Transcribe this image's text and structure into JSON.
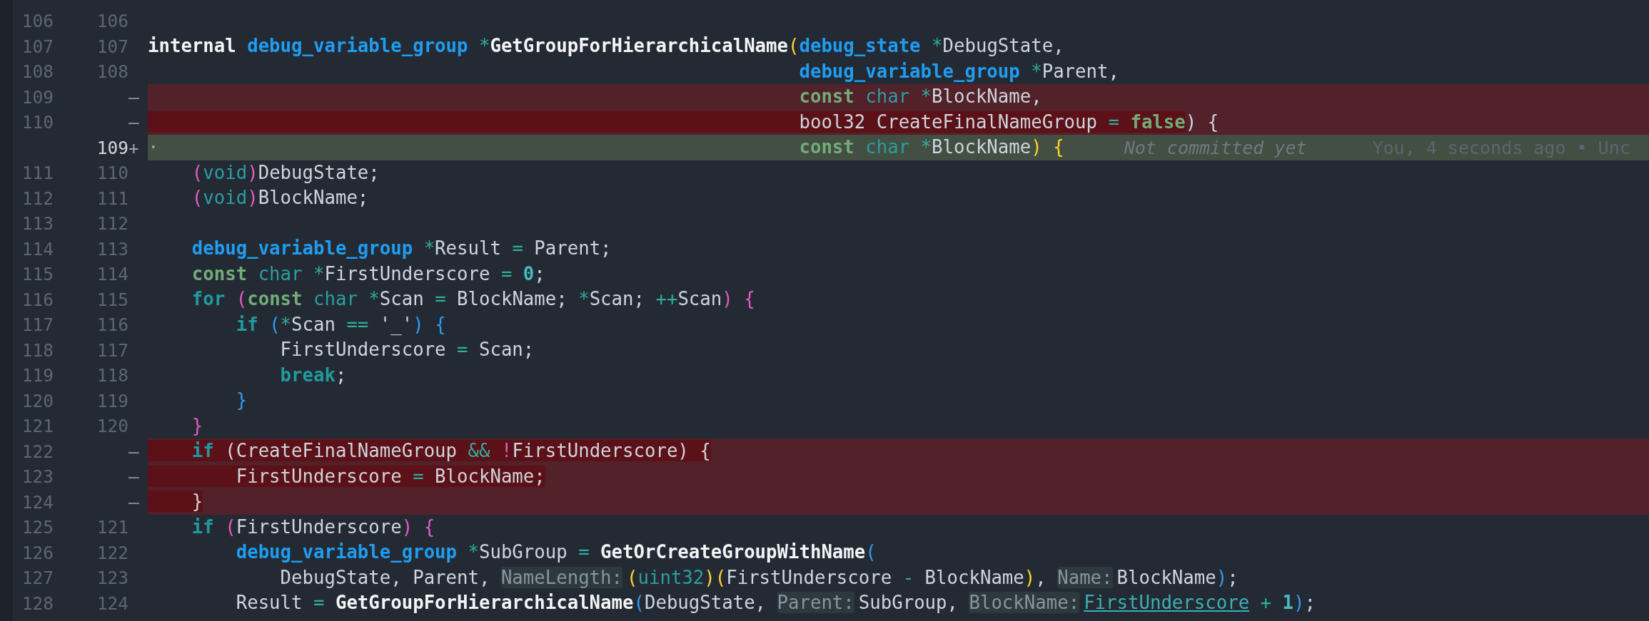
{
  "lines": [
    {
      "old": "106",
      "new": "106",
      "kind": "context"
    },
    {
      "old": "107",
      "new": "107",
      "kind": "context",
      "tokens": [
        {
          "text": "internal ",
          "kind": "storage"
        },
        {
          "text": "debug_variable_group ",
          "kind": "type"
        },
        {
          "text": "*",
          "kind": "op"
        },
        {
          "text": "GetGroupForHierarchicalName",
          "kind": "func"
        },
        {
          "text": "(",
          "kind": "bracket-yellow"
        },
        {
          "text": "debug_state ",
          "kind": "type"
        },
        {
          "text": "*",
          "kind": "op"
        },
        {
          "text": "DebugState,",
          "kind": "plain"
        }
      ]
    },
    {
      "old": "108",
      "new": "108",
      "kind": "context",
      "tokens": [
        {
          "text": "                                                           debug_variable_group ",
          "kind": "type"
        },
        {
          "text": "*",
          "kind": "op"
        },
        {
          "text": "Parent,",
          "kind": "plain"
        }
      ]
    },
    {
      "old": "109",
      "marker": "—",
      "kind": "removed",
      "tokens": [
        {
          "text": "                                                           const ",
          "kind": "keyword",
          "changed": false
        },
        {
          "text": "char ",
          "kind": "primitive",
          "changed": false
        },
        {
          "text": "*",
          "kind": "op",
          "changed": false
        },
        {
          "text": "BlockName,",
          "kind": "plain",
          "changed": false
        }
      ]
    },
    {
      "old": "110",
      "marker": "—",
      "kind": "removed",
      "tokens": [
        {
          "text": "                                                           bool32 CreateFinalNameGroup ",
          "kind": "plain",
          "changed": true
        },
        {
          "text": "= ",
          "kind": "op",
          "changed": true
        },
        {
          "text": "false",
          "kind": "keyword",
          "changed": true
        },
        {
          "text": ") {",
          "kind": "plain",
          "changed": false
        }
      ]
    },
    {
      "new": "109",
      "marker": "+",
      "kind": "added",
      "current": true,
      "tokens": [
        {
          "text": "·                                                          ",
          "kind": "whitespace"
        },
        {
          "text": "const ",
          "kind": "keyword"
        },
        {
          "text": "char ",
          "kind": "primitive"
        },
        {
          "text": "*",
          "kind": "op"
        },
        {
          "text": "BlockName",
          "kind": "plain"
        },
        {
          "text": ")",
          "kind": "bracket-yellow"
        },
        {
          "text": " {",
          "kind": "bracket-yellow"
        }
      ],
      "annotation": {
        "message": "Not committed yet",
        "blame": "You, 4 seconds ago • Unc"
      }
    },
    {
      "old": "111",
      "new": "110",
      "kind": "context",
      "tokens": [
        {
          "text": "    (",
          "kind": "bracket-pink"
        },
        {
          "text": "void",
          "kind": "primitive"
        },
        {
          "text": ")",
          "kind": "bracket-pink"
        },
        {
          "text": "DebugState;",
          "kind": "plain"
        }
      ]
    },
    {
      "old": "112",
      "new": "111",
      "kind": "context",
      "tokens": [
        {
          "text": "    (",
          "kind": "bracket-pink"
        },
        {
          "text": "void",
          "kind": "primitive"
        },
        {
          "text": ")",
          "kind": "bracket-pink"
        },
        {
          "text": "BlockName;",
          "kind": "plain"
        }
      ]
    },
    {
      "old": "113",
      "new": "112",
      "kind": "context"
    },
    {
      "old": "114",
      "new": "113",
      "kind": "context",
      "tokens": [
        {
          "text": "    debug_variable_group ",
          "kind": "type"
        },
        {
          "text": "*",
          "kind": "op"
        },
        {
          "text": "Result ",
          "kind": "plain"
        },
        {
          "text": "=",
          "kind": "op"
        },
        {
          "text": " Parent;",
          "kind": "plain"
        }
      ]
    },
    {
      "old": "115",
      "new": "114",
      "kind": "context",
      "tokens": [
        {
          "text": "    const ",
          "kind": "keyword"
        },
        {
          "text": "char ",
          "kind": "primitive"
        },
        {
          "text": "*",
          "kind": "op"
        },
        {
          "text": "FirstUnderscore ",
          "kind": "plain"
        },
        {
          "text": "= ",
          "kind": "op"
        },
        {
          "text": "0",
          "kind": "number"
        },
        {
          "text": ";",
          "kind": "plain"
        }
      ]
    },
    {
      "old": "116",
      "new": "115",
      "kind": "context",
      "tokens": [
        {
          "text": "    for ",
          "kind": "control"
        },
        {
          "text": "(",
          "kind": "bracket-pink"
        },
        {
          "text": "const ",
          "kind": "keyword"
        },
        {
          "text": "char ",
          "kind": "primitive"
        },
        {
          "text": "*",
          "kind": "op"
        },
        {
          "text": "Scan ",
          "kind": "plain"
        },
        {
          "text": "=",
          "kind": "op"
        },
        {
          "text": " BlockName; ",
          "kind": "plain"
        },
        {
          "text": "*",
          "kind": "op"
        },
        {
          "text": "Scan; ",
          "kind": "plain"
        },
        {
          "text": "++",
          "kind": "op"
        },
        {
          "text": "Scan",
          "kind": "plain"
        },
        {
          "text": ")",
          "kind": "bracket-pink"
        },
        {
          "text": " {",
          "kind": "bracket-pink"
        }
      ]
    },
    {
      "old": "117",
      "new": "116",
      "kind": "context",
      "tokens": [
        {
          "text": "        if ",
          "kind": "control"
        },
        {
          "text": "(",
          "kind": "bracket-blue"
        },
        {
          "text": "*",
          "kind": "op"
        },
        {
          "text": "Scan ",
          "kind": "plain"
        },
        {
          "text": "==",
          "kind": "op"
        },
        {
          "text": " '_'",
          "kind": "plain"
        },
        {
          "text": ")",
          "kind": "bracket-blue"
        },
        {
          "text": " {",
          "kind": "bracket-blue"
        }
      ]
    },
    {
      "old": "118",
      "new": "117",
      "kind": "context",
      "tokens": [
        {
          "text": "            FirstUnderscore ",
          "kind": "plain"
        },
        {
          "text": "=",
          "kind": "op"
        },
        {
          "text": " Scan;",
          "kind": "plain"
        }
      ]
    },
    {
      "old": "119",
      "new": "118",
      "kind": "context",
      "tokens": [
        {
          "text": "            break",
          "kind": "control"
        },
        {
          "text": ";",
          "kind": "plain"
        }
      ]
    },
    {
      "old": "120",
      "new": "119",
      "kind": "context",
      "tokens": [
        {
          "text": "        }",
          "kind": "bracket-blue"
        }
      ]
    },
    {
      "old": "121",
      "new": "120",
      "kind": "context",
      "tokens": [
        {
          "text": "    }",
          "kind": "bracket-pink"
        }
      ]
    },
    {
      "old": "122",
      "marker": "—",
      "kind": "removed",
      "tokens": [
        {
          "text": "    if",
          "kind": "control",
          "changed": true
        },
        {
          "text": " (CreateFinalNameGroup ",
          "kind": "plain",
          "changed": true
        },
        {
          "text": "&& ",
          "kind": "op",
          "changed": true
        },
        {
          "text": "!",
          "kind": "bang",
          "changed": true
        },
        {
          "text": "FirstUnderscore) {",
          "kind": "plain",
          "changed": true
        }
      ]
    },
    {
      "old": "123",
      "marker": "—",
      "kind": "removed",
      "tokens": [
        {
          "text": "        FirstUnderscore ",
          "kind": "plain",
          "changed": true
        },
        {
          "text": "=",
          "kind": "op",
          "changed": true
        },
        {
          "text": " BlockName;",
          "kind": "plain",
          "changed": true
        }
      ]
    },
    {
      "old": "124",
      "marker": "—",
      "kind": "removed",
      "tokens": [
        {
          "text": "    }",
          "kind": "plain",
          "changed": true
        }
      ]
    },
    {
      "old": "125",
      "new": "121",
      "kind": "context",
      "tokens": [
        {
          "text": "    if ",
          "kind": "control"
        },
        {
          "text": "(",
          "kind": "bracket-pink"
        },
        {
          "text": "FirstUnderscore",
          "kind": "plain"
        },
        {
          "text": ")",
          "kind": "bracket-pink"
        },
        {
          "text": " {",
          "kind": "bracket-pink"
        }
      ]
    },
    {
      "old": "126",
      "new": "122",
      "kind": "context",
      "tokens": [
        {
          "text": "        debug_variable_group ",
          "kind": "type"
        },
        {
          "text": "*",
          "kind": "op"
        },
        {
          "text": "SubGroup ",
          "kind": "plain"
        },
        {
          "text": "= ",
          "kind": "op"
        },
        {
          "text": "GetOrCreateGroupWithName",
          "kind": "func"
        },
        {
          "text": "(",
          "kind": "bracket-blue"
        }
      ]
    },
    {
      "old": "127",
      "new": "123",
      "kind": "context",
      "tokens": [
        {
          "text": "            DebugState, Parent, ",
          "kind": "plain"
        },
        {
          "text": "NameLength:",
          "kind": "hint"
        },
        {
          "text": "(",
          "kind": "bracket-yellow"
        },
        {
          "text": "uint32",
          "kind": "primitive"
        },
        {
          "text": ")",
          "kind": "bracket-yellow"
        },
        {
          "text": "(",
          "kind": "bracket-yellow"
        },
        {
          "text": "FirstUnderscore ",
          "kind": "plain"
        },
        {
          "text": "-",
          "kind": "op"
        },
        {
          "text": " BlockName",
          "kind": "plain"
        },
        {
          "text": ")",
          "kind": "bracket-yellow"
        },
        {
          "text": ", ",
          "kind": "plain"
        },
        {
          "text": "Name:",
          "kind": "hint"
        },
        {
          "text": "BlockName",
          "kind": "plain"
        },
        {
          "text": ")",
          "kind": "bracket-blue"
        },
        {
          "text": ";",
          "kind": "plain"
        }
      ]
    },
    {
      "old": "128",
      "new": "124",
      "kind": "context",
      "tokens": [
        {
          "text": "        Result ",
          "kind": "plain"
        },
        {
          "text": "= ",
          "kind": "op"
        },
        {
          "text": "GetGroupForHierarchicalName",
          "kind": "func"
        },
        {
          "text": "(",
          "kind": "bracket-blue"
        },
        {
          "text": "DebugState, ",
          "kind": "plain"
        },
        {
          "text": "Parent:",
          "kind": "hint"
        },
        {
          "text": "SubGroup, ",
          "kind": "plain"
        },
        {
          "text": "BlockName:",
          "kind": "hint"
        },
        {
          "text": "FirstUnderscore",
          "kind": "link"
        },
        {
          "text": " + ",
          "kind": "op"
        },
        {
          "text": "1",
          "kind": "number"
        },
        {
          "text": ")",
          "kind": "bracket-blue"
        },
        {
          "text": ";",
          "kind": "plain"
        }
      ]
    }
  ]
}
